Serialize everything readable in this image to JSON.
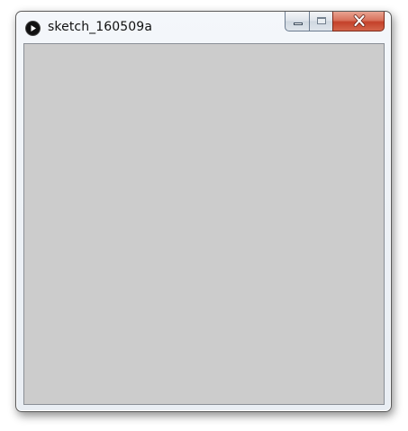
{
  "window": {
    "title": "sketch_160509a",
    "app_icon": "play-circle-icon",
    "canvas_color": "#cccccc",
    "controls": {
      "minimize_icon": "minimize-icon",
      "maximize_icon": "maximize-icon",
      "close_icon": "close-icon",
      "close_color": "#c7432d"
    }
  }
}
